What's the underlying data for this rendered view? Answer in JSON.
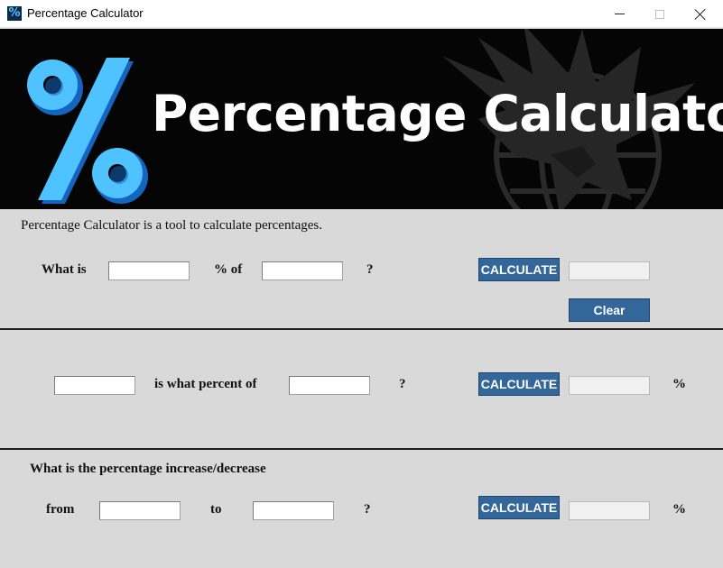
{
  "window": {
    "title": "Percentage Calculator",
    "icon": "percent-app-icon",
    "controls": [
      "minimize",
      "maximize",
      "close"
    ]
  },
  "banner": {
    "title": "Percentage Calculator",
    "logo_glyph": "%",
    "accent_color": "#4fc3ff",
    "background_color": "#050505"
  },
  "intro": "Percentage Calculator is a tool to calculate percentages.",
  "section1": {
    "prefix": "What is",
    "middle": "% of",
    "suffix": "?",
    "input_a": "",
    "input_b": "",
    "calculate_label": "CALCULATE",
    "result": "",
    "clear_label": "Clear"
  },
  "section2": {
    "middle": "is what percent of",
    "suffix": "?",
    "input_a": "",
    "input_b": "",
    "calculate_label": "CALCULATE",
    "result": "",
    "unit": "%"
  },
  "section3": {
    "heading": "What is the percentage increase/decrease",
    "from_label": "from",
    "to_label": "to",
    "suffix": "?",
    "input_a": "",
    "input_b": "",
    "calculate_label": "CALCULATE",
    "result": "",
    "unit": "%"
  },
  "colors": {
    "button": "#336699",
    "panel": "#d9d9d9"
  }
}
